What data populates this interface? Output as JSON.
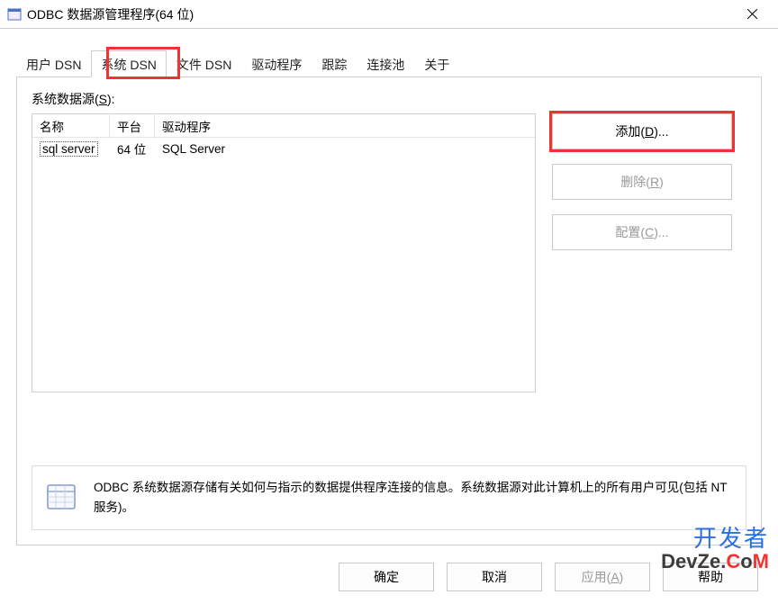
{
  "window": {
    "title": "ODBC 数据源管理程序(64 位)"
  },
  "tabs": [
    {
      "label": "用户 DSN",
      "active": false
    },
    {
      "label": "系统 DSN",
      "active": true
    },
    {
      "label": "文件 DSN",
      "active": false
    },
    {
      "label": "驱动程序",
      "active": false
    },
    {
      "label": "跟踪",
      "active": false
    },
    {
      "label": "连接池",
      "active": false
    },
    {
      "label": "关于",
      "active": false
    }
  ],
  "panel": {
    "ds_label": "系统数据源(S):",
    "columns": {
      "name": "名称",
      "platform": "平台",
      "driver": "驱动程序"
    },
    "rows": [
      {
        "name": "sql server",
        "platform": "64 位",
        "driver": "SQL Server"
      }
    ],
    "buttons": {
      "add": "添加(D)...",
      "remove": "删除(R)",
      "configure": "配置(C)..."
    },
    "info": "ODBC 系统数据源存储有关如何与指示的数据提供程序连接的信息。系统数据源对此计算机上的所有用户可见(包括 NT 服务)。"
  },
  "footer": {
    "ok": "确定",
    "cancel": "取消",
    "apply": "应用(A)",
    "help": "帮助"
  },
  "watermark": {
    "line1": "开发者",
    "line2_pre": "DevZe.",
    "line2_accent": "C",
    "line2_post": "o",
    "line2_m": "M"
  }
}
